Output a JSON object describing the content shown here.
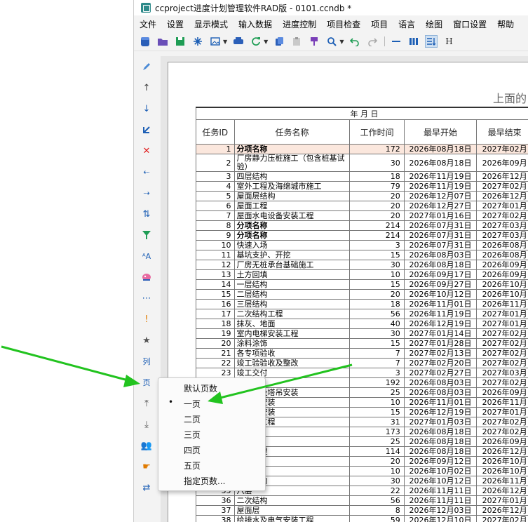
{
  "window": {
    "title": "ccproject进度计划管理软件RAD版 - 0101.ccndb *"
  },
  "menubar": [
    "文件",
    "设置",
    "显示模式",
    "输入数据",
    "进度控制",
    "项目检查",
    "项目",
    "语言",
    "绘图",
    "窗口设置",
    "帮助"
  ],
  "toolbar": {
    "last_label": "H"
  },
  "sidetool": {
    "col_label": "列",
    "page_label": "页"
  },
  "page": {
    "heading": "上面的"
  },
  "table": {
    "date_header": "年 月 日",
    "columns": [
      "任务ID",
      "任务名称",
      "工作时间",
      "最早开始",
      "最早结束"
    ],
    "rows": [
      {
        "id": "1",
        "name": "分项名称",
        "dur": "172",
        "start": "2026年08月18日",
        "end": "2027年02月",
        "indent": 0,
        "bold": true
      },
      {
        "id": "2",
        "name": "厂房静力压桩施工（包含桩基试验）",
        "dur": "30",
        "start": "2026年08月18日",
        "end": "2026年09月",
        "indent": 1
      },
      {
        "id": "3",
        "name": "四层结构",
        "dur": "18",
        "start": "2026年11月19日",
        "end": "2026年12月",
        "indent": 1
      },
      {
        "id": "4",
        "name": "室外工程及海绵城市施工",
        "dur": "79",
        "start": "2026年11月19日",
        "end": "2027年02月",
        "indent": 1
      },
      {
        "id": "5",
        "name": "屋面层结构",
        "dur": "20",
        "start": "2026年12月07日",
        "end": "2026年12月",
        "indent": 1
      },
      {
        "id": "6",
        "name": "屋面工程",
        "dur": "20",
        "start": "2026年12月27日",
        "end": "2027年01月",
        "indent": 1
      },
      {
        "id": "7",
        "name": "屋面水电设备安装工程",
        "dur": "20",
        "start": "2027年01月16日",
        "end": "2027年02月",
        "indent": 1
      },
      {
        "id": "8",
        "name": "分项名称",
        "dur": "214",
        "start": "2026年07月31日",
        "end": "2027年03月",
        "indent": 0,
        "bold": true
      },
      {
        "id": "9",
        "name": "分项名称",
        "dur": "214",
        "start": "2026年07月31日",
        "end": "2027年03月",
        "indent": 1,
        "bold": true
      },
      {
        "id": "10",
        "name": "快速入场",
        "dur": "3",
        "start": "2026年07月31日",
        "end": "2026年08月",
        "indent": 2
      },
      {
        "id": "11",
        "name": "基坑支护、开挖",
        "dur": "15",
        "start": "2026年08月03日",
        "end": "2026年08月",
        "indent": 2
      },
      {
        "id": "12",
        "name": "厂房无桩承台基础施工",
        "dur": "30",
        "start": "2026年08月18日",
        "end": "2026年09月",
        "indent": 2
      },
      {
        "id": "13",
        "name": "土方回填",
        "dur": "10",
        "start": "2026年09月17日",
        "end": "2026年09月",
        "indent": 2
      },
      {
        "id": "14",
        "name": "一层结构",
        "dur": "15",
        "start": "2026年09月27日",
        "end": "2026年10月",
        "indent": 2
      },
      {
        "id": "15",
        "name": "二层结构",
        "dur": "20",
        "start": "2026年10月12日",
        "end": "2026年10月",
        "indent": 2
      },
      {
        "id": "16",
        "name": "三层结构",
        "dur": "18",
        "start": "2026年11月01日",
        "end": "2026年11月",
        "indent": 2
      },
      {
        "id": "17",
        "name": "二次结构工程",
        "dur": "56",
        "start": "2026年11月19日",
        "end": "2027年01月",
        "indent": 2
      },
      {
        "id": "18",
        "name": "抹灰、地面",
        "dur": "40",
        "start": "2026年12月19日",
        "end": "2027年01月",
        "indent": 2
      },
      {
        "id": "19",
        "name": "室内电梯安装工程",
        "dur": "30",
        "start": "2027年01月14日",
        "end": "2027年02月",
        "indent": 2
      },
      {
        "id": "20",
        "name": "涂料涂饰",
        "dur": "15",
        "start": "2027年01月28日",
        "end": "2027年02月",
        "indent": 2
      },
      {
        "id": "21",
        "name": "各专项验收",
        "dur": "7",
        "start": "2027年02月13日",
        "end": "2027年02月",
        "indent": 2
      },
      {
        "id": "22",
        "name": "竣工验验收及整改",
        "dur": "7",
        "start": "2027年02月20日",
        "end": "2027年02月",
        "indent": 2
      },
      {
        "id": "23",
        "name": "竣工交付",
        "dur": "3",
        "start": "2027年02月27日",
        "end": "2027年03月",
        "indent": 2
      },
      {
        "id": "24",
        "name": "名称",
        "dur": "192",
        "start": "2026年08月03日",
        "end": "2027年02月",
        "indent": 1,
        "bold": true
      },
      {
        "id": "25",
        "name": "吊基础及塔吊安装",
        "dur": "25",
        "start": "2026年08月03日",
        "end": "2026年09月",
        "indent": 2
      },
      {
        "id": "26",
        "name": "工电梯安装",
        "dur": "10",
        "start": "2026年11月01日",
        "end": "2026年11月",
        "indent": 2
      },
      {
        "id": "27",
        "name": "门窗框安装",
        "dur": "15",
        "start": "2026年12月19日",
        "end": "2027年01月",
        "indent": 2
      },
      {
        "id": "28",
        "name": "窗安装工程",
        "dur": "31",
        "start": "2027年01月03日",
        "end": "2027年02月",
        "indent": 2
      },
      {
        "id": "29",
        "name": "称",
        "dur": "173",
        "start": "2026年08月18日",
        "end": "2027年02月",
        "indent": 1,
        "bold": true
      },
      {
        "id": "30",
        "name": "楼基础",
        "dur": "25",
        "start": "2026年08月18日",
        "end": "2026年09月",
        "indent": 2
      },
      {
        "id": "31",
        "name": "桥留预埋",
        "dur": "114",
        "start": "2026年08月18日",
        "end": "2026年12月",
        "indent": 2
      },
      {
        "id": "32",
        "name": "水池",
        "dur": "20",
        "start": "2026年09月12日",
        "end": "2026年10月",
        "indent": 2
      },
      {
        "id": "33",
        "name": "回填",
        "dur": "10",
        "start": "2026年10月02日",
        "end": "2026年10月",
        "indent": 2
      },
      {
        "id": "34",
        "name": "三层结构",
        "dur": "30",
        "start": "2026年10月12日",
        "end": "2026年11月",
        "indent": 2
      },
      {
        "id": "35",
        "name": "六层",
        "dur": "22",
        "start": "2026年11月11日",
        "end": "2026年12月",
        "indent": 2
      },
      {
        "id": "36",
        "name": "二次结构",
        "dur": "56",
        "start": "2026年11月11日",
        "end": "2027年01月",
        "indent": 1
      },
      {
        "id": "37",
        "name": "屋面层",
        "dur": "8",
        "start": "2026年12月03日",
        "end": "2026年12月",
        "indent": 1
      },
      {
        "id": "38",
        "name": "给排水及电气安装工程",
        "dur": "59",
        "start": "2026年12月10日",
        "end": "2027年02月",
        "indent": 1
      }
    ]
  },
  "context_menu": {
    "items": [
      "默认页数",
      "一页",
      "二页",
      "三页",
      "四页",
      "五页",
      "指定页数..."
    ],
    "checked_index": 1,
    "checked_mark": "•"
  },
  "colors": {
    "arrow": "#22c31f",
    "selected_row": "#fbe7dd",
    "toolbar_blue": "#1d5fb5"
  }
}
